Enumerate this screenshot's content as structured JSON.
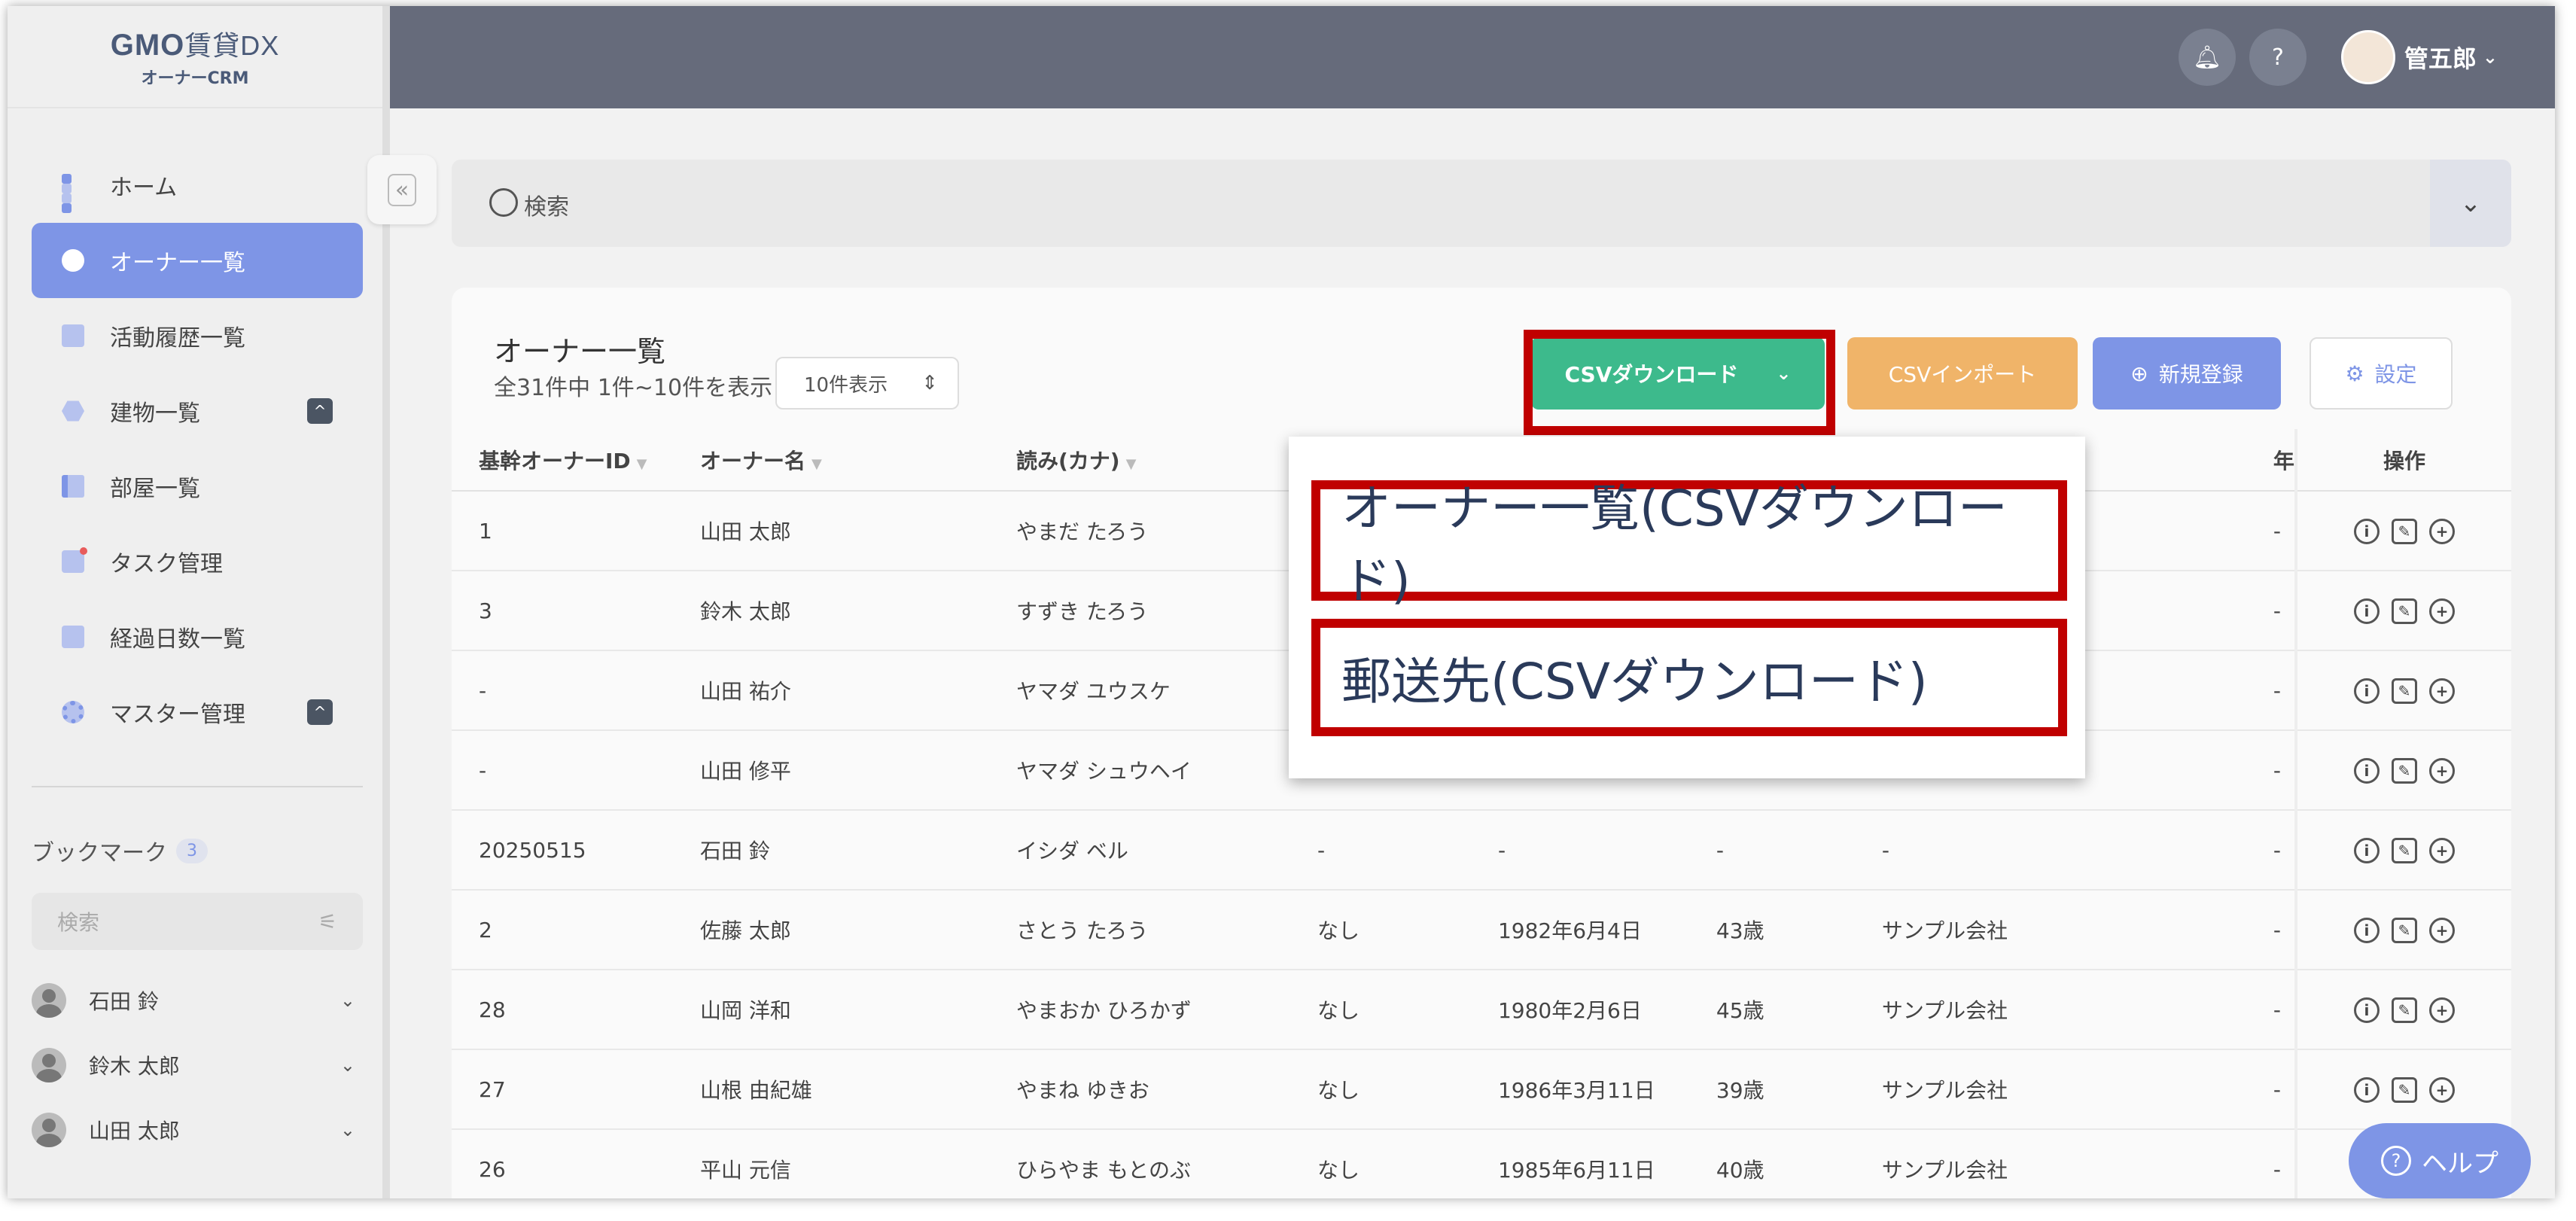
{
  "brand": {
    "logo": "GMO",
    "product": "賃貸DX",
    "sub": "オーナーCRM"
  },
  "sidebar": {
    "items": [
      {
        "label": "ホーム",
        "icon": "home-icon"
      },
      {
        "label": "オーナー一覧",
        "icon": "user-icon",
        "active": true
      },
      {
        "label": "活動履歴一覧",
        "icon": "document-icon"
      },
      {
        "label": "建物一覧",
        "icon": "building-icon",
        "badge": "^"
      },
      {
        "label": "部屋一覧",
        "icon": "book-icon"
      },
      {
        "label": "タスク管理",
        "icon": "task-icon"
      },
      {
        "label": "経過日数一覧",
        "icon": "message-icon"
      },
      {
        "label": "マスター管理",
        "icon": "gear-icon",
        "badge": "^"
      }
    ],
    "bookmark_title": "ブックマーク",
    "bookmark_count": "3",
    "bookmark_search_placeholder": "検索",
    "bookmarks": [
      "石田 鈴",
      "鈴木 太郎",
      "山田 太郎"
    ]
  },
  "header": {
    "user_name": "管五郎"
  },
  "search": {
    "placeholder": "検索"
  },
  "card": {
    "title": "オーナー一覧",
    "count_text": "全31件中 1件~10件を表示",
    "per_page": "10件表示",
    "csv_download": "CSVダウンロード",
    "csv_import": "CSVインポート",
    "new_register": "新規登録",
    "settings": "設定"
  },
  "table": {
    "headers": [
      "基幹オーナーID",
      "オーナー名",
      "読み(カナ)",
      "",
      "",
      "",
      "",
      "年",
      "操作"
    ],
    "rows": [
      [
        "1",
        "山田 太郎",
        "やまだ たろう",
        "",
        "",
        "",
        "",
        "-"
      ],
      [
        "3",
        "鈴木 太郎",
        "すずき たろう",
        "",
        "",
        "",
        "",
        "-"
      ],
      [
        "-",
        "山田 祐介",
        "ヤマダ ユウスケ",
        "",
        "",
        "",
        "",
        "-"
      ],
      [
        "-",
        "山田 修平",
        "ヤマダ シュウヘイ",
        "",
        "",
        "",
        "",
        "-"
      ],
      [
        "20250515",
        "石田 鈴",
        "イシダ ベル",
        "-",
        "-",
        "-",
        "-",
        "-"
      ],
      [
        "2",
        "佐藤 太郎",
        "さとう たろう",
        "なし",
        "1982年6月4日",
        "43歳",
        "サンプル会社",
        "-"
      ],
      [
        "28",
        "山岡 洋和",
        "やまおか ひろかず",
        "なし",
        "1980年2月6日",
        "45歳",
        "サンプル会社",
        "-"
      ],
      [
        "27",
        "山根 由紀雄",
        "やまね ゆきお",
        "なし",
        "1986年3月11日",
        "39歳",
        "サンプル会社",
        "-"
      ],
      [
        "26",
        "平山 元信",
        "ひらやま もとのぶ",
        "なし",
        "1985年6月11日",
        "40歳",
        "サンプル会社",
        "-"
      ]
    ]
  },
  "dropdown": {
    "items": [
      "オーナー一覧(CSVダウンロード)",
      "郵送先(CSVダウンロード)"
    ]
  },
  "help": {
    "label": "ヘルプ"
  },
  "colors": {
    "accent": "#7e95e6",
    "csv": "#3dba8c",
    "import": "#f0b469",
    "highlight": "#c00000",
    "header": "#666b7b"
  }
}
